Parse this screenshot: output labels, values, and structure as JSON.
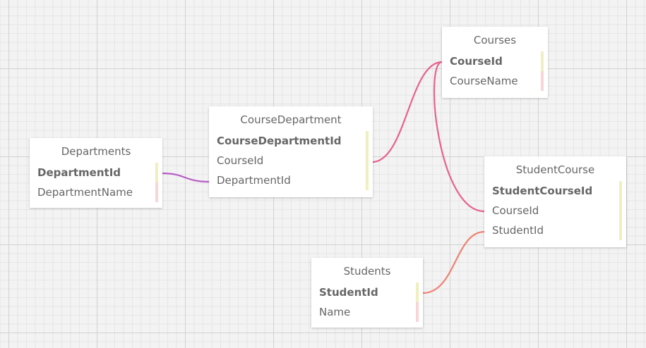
{
  "entities": {
    "departments": {
      "name": "Departments",
      "fields": [
        {
          "name": "DepartmentId",
          "key": "pk"
        },
        {
          "name": "DepartmentName",
          "key": "none"
        }
      ]
    },
    "course_department": {
      "name": "CourseDepartment",
      "fields": [
        {
          "name": "CourseDepartmentId",
          "key": "pk"
        },
        {
          "name": "CourseId",
          "key": "fk"
        },
        {
          "name": "DepartmentId",
          "key": "fk"
        }
      ]
    },
    "courses": {
      "name": "Courses",
      "fields": [
        {
          "name": "CourseId",
          "key": "pk"
        },
        {
          "name": "CourseName",
          "key": "none"
        }
      ]
    },
    "student_course": {
      "name": "StudentCourse",
      "fields": [
        {
          "name": "StudentCourseId",
          "key": "pk"
        },
        {
          "name": "CourseId",
          "key": "fk"
        },
        {
          "name": "StudentId",
          "key": "fk"
        }
      ]
    },
    "students": {
      "name": "Students",
      "fields": [
        {
          "name": "StudentId",
          "key": "pk"
        },
        {
          "name": "Name",
          "key": "none"
        }
      ]
    }
  },
  "relationships": [
    {
      "from": "departments.DepartmentId",
      "to": "course_department.DepartmentId",
      "color": "#b85fc6"
    },
    {
      "from": "courses.CourseId",
      "to": "course_department.CourseId",
      "color": "#e8628a"
    },
    {
      "from": "courses.CourseId",
      "to": "student_course.CourseId",
      "color": "#e8628a"
    },
    {
      "from": "students.StudentId",
      "to": "student_course.StudentId",
      "color": "#ef8272"
    }
  ],
  "colors": {
    "pk_bar": "#efefc0",
    "fk_bar": "#efefc0",
    "field_bar": "#f8d6d6",
    "text": "#666666"
  }
}
